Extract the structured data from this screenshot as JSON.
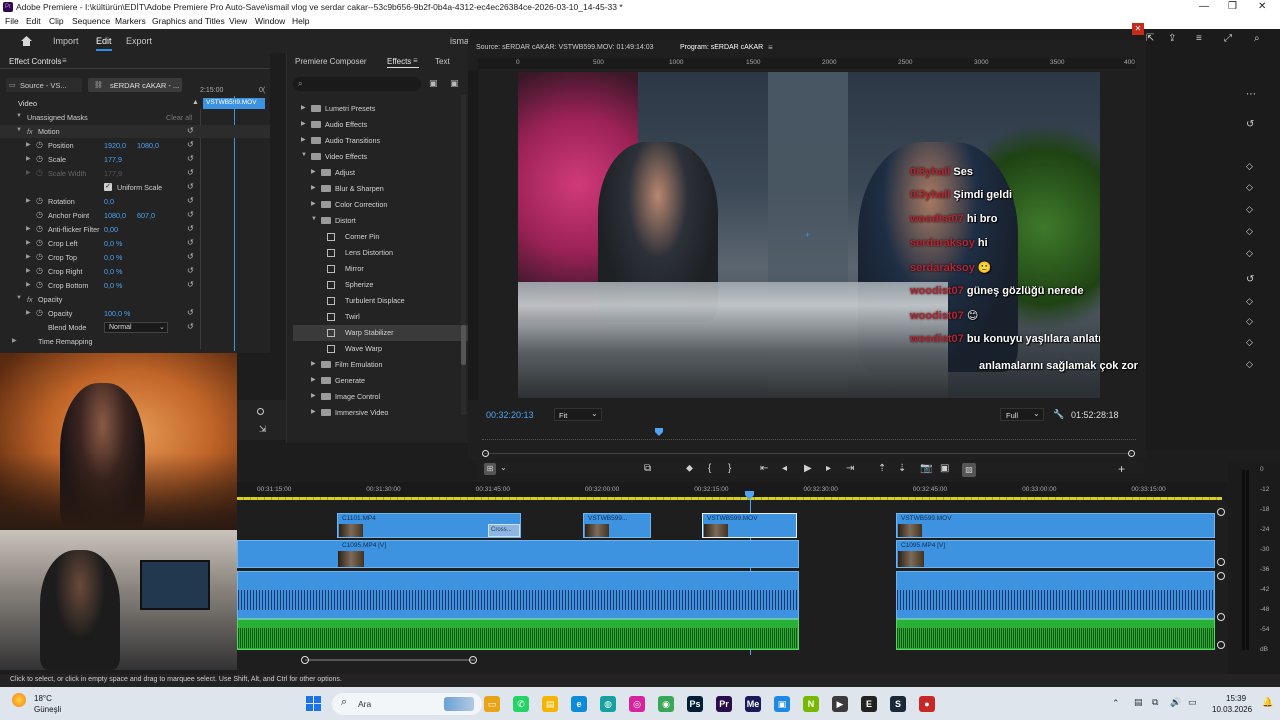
{
  "window": {
    "title": "Adobe Premiere - I:\\kültürün\\EDİT\\Adobe Premiere Pro Auto-Save\\ismail vlog ve serdar cakar--53c9b656-9b2f-0b4a-4312-ec4ec26384ce-2026-03-10_14-45-33 *",
    "app_icon": "Pr"
  },
  "menu": [
    "File",
    "Edit",
    "Clip",
    "Sequence",
    "Markers",
    "Graphics and Titles",
    "View",
    "Window",
    "Help"
  ],
  "workspace": {
    "home_icon": "home-icon",
    "tabs": [
      "Import",
      "Edit",
      "Export"
    ],
    "active": "Edit",
    "project_name": "isma"
  },
  "effect_controls": {
    "title": "Effect Controls",
    "source_tab": "Source - VS...",
    "sequence_tab": "sERDAR cAKAR - ...",
    "timecode": "2:15:00",
    "timecode2": "0(",
    "clip_label": "VSTWB599.MOV",
    "section": "Video",
    "unassigned_masks": "Unassigned Masks",
    "clear_all": "Clear all",
    "motion": "Motion",
    "position_label": "Position",
    "position_x": "1920,0",
    "position_y": "1080,0",
    "scale_label": "Scale",
    "scale": "177,9",
    "scale_width_label": "Scale Width",
    "scale_width": "177,9",
    "uniform_scale": "Uniform Scale",
    "rotation_label": "Rotation",
    "rotation": "0,0",
    "anchor_label": "Anchor Point",
    "anchor_x": "1080,0",
    "anchor_y": "607,0",
    "antiflicker_label": "Anti-flicker Filter",
    "antiflicker": "0,00",
    "crop_left_label": "Crop Left",
    "crop_left": "0,0 %",
    "crop_top_label": "Crop Top",
    "crop_top": "0,0 %",
    "crop_right_label": "Crop Right",
    "crop_right": "0,0 %",
    "crop_bottom_label": "Crop Bottom",
    "crop_bottom": "0,0 %",
    "opacity_section": "Opacity",
    "opacity_label": "Opacity",
    "opacity": "100,0 %",
    "blend_label": "Blend Mode",
    "blend": "Normal",
    "time_remapping": "Time Remapping"
  },
  "effects_panel": {
    "tabs": [
      "Premiere Composer",
      "Effects",
      "Text"
    ],
    "active_tab": "Effects",
    "search_placeholder": "",
    "items": [
      {
        "label": "Lumetri Presets",
        "kind": "folder",
        "level": 0,
        "open": false
      },
      {
        "label": "Audio Effects",
        "kind": "folder",
        "level": 0,
        "open": false
      },
      {
        "label": "Audio Transitions",
        "kind": "folder",
        "level": 0,
        "open": false
      },
      {
        "label": "Video Effects",
        "kind": "folder",
        "level": 0,
        "open": true
      },
      {
        "label": "Adjust",
        "kind": "folder",
        "level": 1,
        "open": false
      },
      {
        "label": "Blur & Sharpen",
        "kind": "folder",
        "level": 1,
        "open": false
      },
      {
        "label": "Color Correction",
        "kind": "folder",
        "level": 1,
        "open": false
      },
      {
        "label": "Distort",
        "kind": "folder",
        "level": 1,
        "open": true
      },
      {
        "label": "Corner Pin",
        "kind": "effect",
        "level": 2
      },
      {
        "label": "Lens Distortion",
        "kind": "effect",
        "level": 2
      },
      {
        "label": "Mirror",
        "kind": "effect",
        "level": 2
      },
      {
        "label": "Spherize",
        "kind": "effect",
        "level": 2
      },
      {
        "label": "Turbulent Displace",
        "kind": "effect",
        "level": 2
      },
      {
        "label": "Twirl",
        "kind": "effect",
        "level": 2
      },
      {
        "label": "Warp Stabilizer",
        "kind": "effect",
        "level": 2,
        "selected": true
      },
      {
        "label": "Wave Warp",
        "kind": "effect",
        "level": 2
      },
      {
        "label": "Film Emulation",
        "kind": "folder",
        "level": 1,
        "open": false
      },
      {
        "label": "Generate",
        "kind": "folder",
        "level": 1,
        "open": false
      },
      {
        "label": "Image Control",
        "kind": "folder",
        "level": 1,
        "open": false
      },
      {
        "label": "Immersive Video",
        "kind": "folder",
        "level": 1,
        "open": false
      }
    ]
  },
  "monitor": {
    "source_label": "Source: sERDAR cAKAR: VSTWB599.MOV: 01:49:14:03",
    "program_label": "Program: sERDAR cAKAR",
    "ruler_ticks": [
      "0",
      "500",
      "1000",
      "1500",
      "2000",
      "2500",
      "3000",
      "3500",
      "400"
    ],
    "timecode": "00:32:20:13",
    "fit": "Fit",
    "quality": "Full",
    "duration": "01:52:28:18",
    "playhead_progress": 0.27
  },
  "chat": [
    {
      "user": "0i3yhall",
      "msg": "Ses"
    },
    {
      "user": "0i3yhall",
      "msg": "Şimdi geldi"
    },
    {
      "user": "woodist07",
      "msg": "hi bro"
    },
    {
      "user": "serdaraksoy",
      "msg": "hi"
    },
    {
      "user": "serdaraksoy",
      "msg": "🙂"
    },
    {
      "user": "woodist07",
      "msg": "güneş gözlüğü nerede"
    },
    {
      "user": "woodist07",
      "msg": "😊"
    },
    {
      "user": "woodist07",
      "msg": "bu konuyu yaşlılara anlatmak aradaki farkı"
    },
    {
      "user": "",
      "msg": "anlamalarını sağlamak çok zor"
    }
  ],
  "timeline": {
    "ruler": [
      "00:31:15:00",
      "00:31:30:00",
      "00:31:45:00",
      "00:32:00:00",
      "00:32:15:00",
      "00:32:30:00",
      "00:32:45:00",
      "00:33:00:00",
      "00:33:15:00"
    ],
    "clips_v2": [
      "C1101.MP4",
      "VSTWB599...",
      "VSTWB599.MOV",
      "VSTWB599.MOV"
    ],
    "clips_v1": [
      "C1095.MP4 [V]",
      "C1095.MP4 [V]"
    ],
    "small_clip": "Cross..."
  },
  "meter": {
    "labels": [
      "0",
      "-12",
      "-18",
      "-24",
      "-30",
      "-36",
      "-42",
      "-48",
      "-54",
      "dB"
    ]
  },
  "status": {
    "hint": "Click to select, or click in empty space and drag to marquee select. Use Shift, Alt, and Ctrl for other options."
  },
  "taskbar": {
    "weather_temp": "18°C",
    "weather_desc": "Güneşli",
    "search": "Ara",
    "clock_time": "15:39",
    "clock_date": "10.03.2026",
    "apps": [
      "folder",
      "whatsapp",
      "files",
      "edge",
      "chrome-alt",
      "instagram",
      "chrome",
      "photoshop",
      "premiere",
      "media-encoder",
      "app",
      "nvidia",
      "terminal",
      "epic",
      "steam",
      "game"
    ]
  }
}
